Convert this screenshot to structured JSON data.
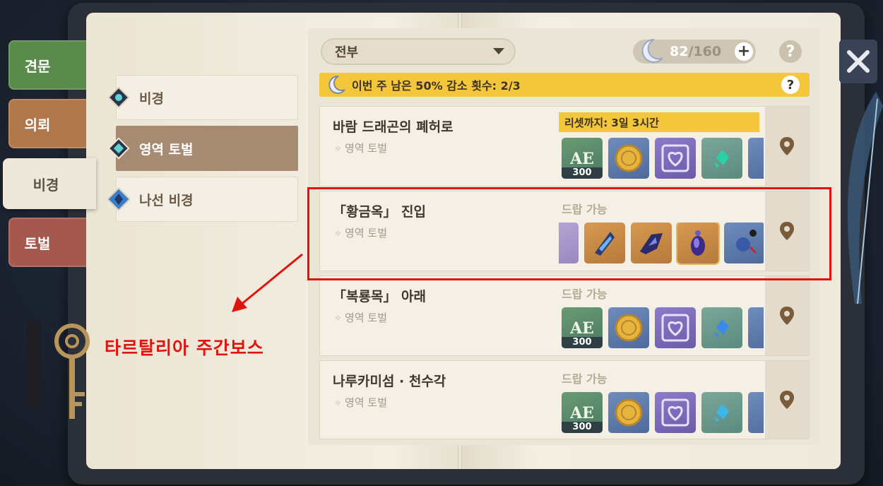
{
  "side_tabs": {
    "explore": "견문",
    "request": "의뢰",
    "domain": "비경",
    "boss": "토벌"
  },
  "categories": [
    {
      "label": "비경",
      "selected": false
    },
    {
      "label": "영역 토벌",
      "selected": true
    },
    {
      "label": "나선 비경",
      "selected": false
    }
  ],
  "filter": {
    "selected": "전부"
  },
  "resin": {
    "current": "82",
    "max": "/160"
  },
  "banner": {
    "text": "이번 주 남은 50% 감소 횟수: 2/3"
  },
  "rows": [
    {
      "name": "바람 드래곤의 폐허로",
      "category": "영역 토벌",
      "reset": "리셋까지: 3일 3시간",
      "items": [
        {
          "icon": "adventure-exp-icon",
          "bg": "green",
          "qty": "300"
        },
        {
          "icon": "mora-coin-icon",
          "bg": "blue"
        },
        {
          "icon": "companionship-exp-icon",
          "bg": "purple"
        },
        {
          "icon": "gem-fragment-icon",
          "bg": "teal"
        },
        {
          "icon": "item-partial-icon",
          "bg": "blue"
        }
      ]
    },
    {
      "name": "「황금옥」 진입",
      "category": "영역 토벌",
      "drop": "드랍 가능",
      "items": [
        {
          "icon": "crystal-partial-icon",
          "bg": "lilac"
        },
        {
          "icon": "shard-of-foul-legacy-icon",
          "bg": "orange"
        },
        {
          "icon": "tusk-of-monoceros-caeli-icon",
          "bg": "orange"
        },
        {
          "icon": "shadow-of-warrior-icon",
          "bg": "orange"
        },
        {
          "icon": "artifact-flower-icon",
          "bg": "blue"
        }
      ]
    },
    {
      "name": "「복룡목」 아래",
      "category": "영역 토벌",
      "drop": "드랍 가능",
      "items": [
        {
          "icon": "adventure-exp-icon",
          "bg": "green",
          "qty": "300"
        },
        {
          "icon": "mora-coin-icon",
          "bg": "blue"
        },
        {
          "icon": "companionship-exp-icon",
          "bg": "purple"
        },
        {
          "icon": "gem-fragment-icon",
          "bg": "teal"
        },
        {
          "icon": "item-partial-icon",
          "bg": "blue"
        }
      ]
    },
    {
      "name": "나루카미섬 · 천수각",
      "category": "영역 토벌",
      "drop": "드랍 가능",
      "items": [
        {
          "icon": "adventure-exp-icon",
          "bg": "green",
          "qty": "300"
        },
        {
          "icon": "mora-coin-icon",
          "bg": "blue"
        },
        {
          "icon": "companionship-exp-icon",
          "bg": "purple"
        },
        {
          "icon": "gem-fragment-icon",
          "bg": "teal"
        },
        {
          "icon": "item-partial-icon",
          "bg": "blue"
        }
      ]
    }
  ],
  "annotation": {
    "text": "타르탈리아 주간보스",
    "color": "#e0140e"
  }
}
